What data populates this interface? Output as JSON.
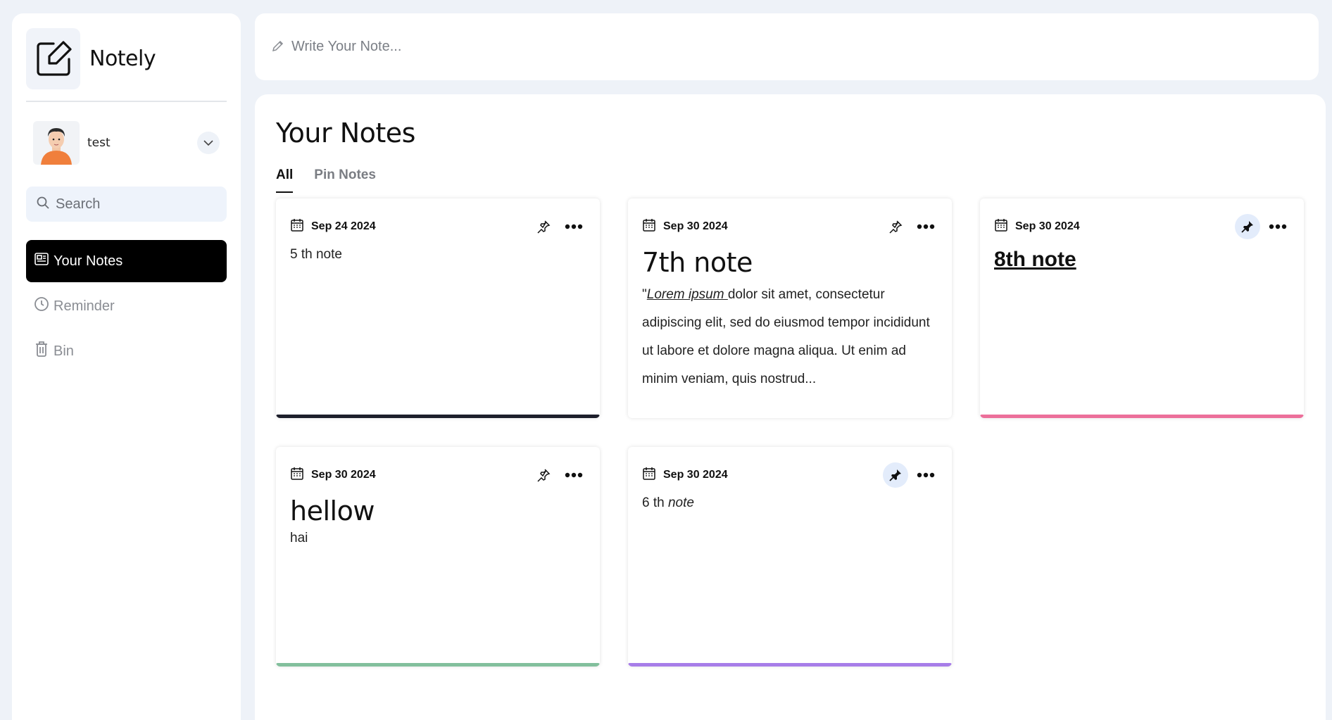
{
  "brand": {
    "name": "Notely"
  },
  "user": {
    "name": "test"
  },
  "search": {
    "placeholder": "Search"
  },
  "nav": [
    {
      "label": "Your Notes",
      "icon": "notes-icon",
      "active": true
    },
    {
      "label": "Reminder",
      "icon": "clock-icon",
      "active": false
    },
    {
      "label": "Bin",
      "icon": "trash-icon",
      "active": false
    }
  ],
  "compose": {
    "placeholder": "Write Your Note..."
  },
  "main": {
    "title": "Your Notes",
    "tabs": [
      "All",
      "Pin Notes"
    ]
  },
  "notes": [
    {
      "date": "Sep 24 2024",
      "pinned": false,
      "body": "5 th note",
      "bar_color": "#1d1f2b"
    },
    {
      "date": "Sep 30 2024",
      "pinned": false,
      "heading": "7th note",
      "quote": "\"",
      "link": "Lorem ipsum ",
      "text": "dolor sit amet, consectetur adipiscing elit, sed do eiusmod tempor incididunt ut labore et dolore magna aliqua. Ut enim ad minim veniam, quis nostrud...",
      "bar_color": ""
    },
    {
      "date": "Sep 30 2024",
      "pinned": true,
      "heading": "8th note",
      "bar_color": "#ec6f9a"
    },
    {
      "date": "Sep 30 2024",
      "pinned": false,
      "heading": "hellow",
      "body": "hai",
      "bar_color": "#82bf9c"
    },
    {
      "date": "Sep 30 2024",
      "pinned": true,
      "body_prefix": "6 th ",
      "body_em": "note",
      "bar_color": "#a77de8"
    }
  ]
}
